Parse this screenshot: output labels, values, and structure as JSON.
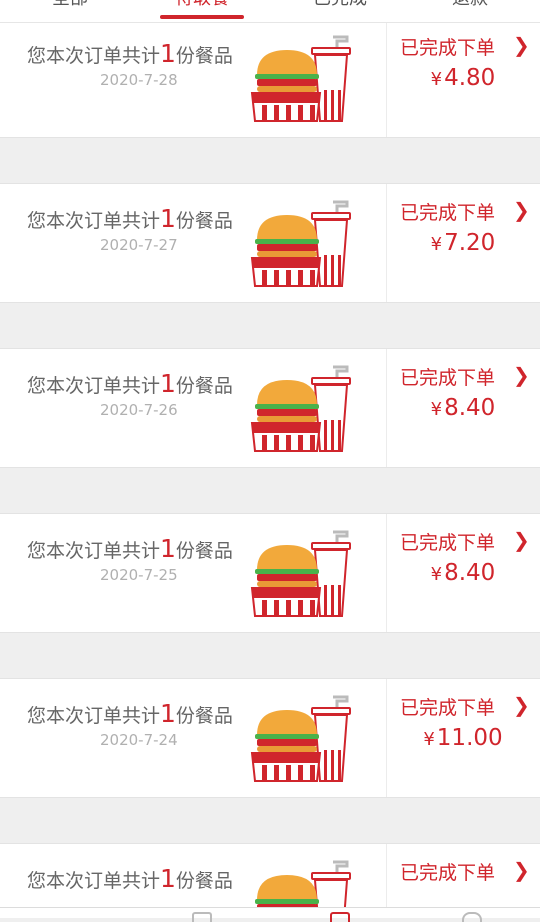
{
  "tabs": [
    {
      "label": "全部"
    },
    {
      "label": "待取餐"
    },
    {
      "label": "已完成"
    },
    {
      "label": "退款"
    }
  ],
  "active_tab": 1,
  "orders": [
    {
      "summary_prefix": "您本次订单共计",
      "count": "1",
      "summary_suffix": "份餐品",
      "date": "2020-7-28",
      "status": "已完成下单",
      "currency": "¥",
      "price": "4.80"
    },
    {
      "summary_prefix": "您本次订单共计",
      "count": "1",
      "summary_suffix": "份餐品",
      "date": "2020-7-27",
      "status": "已完成下单",
      "currency": "¥",
      "price": "7.20"
    },
    {
      "summary_prefix": "您本次订单共计",
      "count": "1",
      "summary_suffix": "份餐品",
      "date": "2020-7-26",
      "status": "已完成下单",
      "currency": "¥",
      "price": "8.40"
    },
    {
      "summary_prefix": "您本次订单共计",
      "count": "1",
      "summary_suffix": "份餐品",
      "date": "2020-7-25",
      "status": "已完成下单",
      "currency": "¥",
      "price": "8.40"
    },
    {
      "summary_prefix": "您本次订单共计",
      "count": "1",
      "summary_suffix": "份餐品",
      "date": "2020-7-24",
      "status": "已完成下单",
      "currency": "¥",
      "price": "11.00"
    },
    {
      "summary_prefix": "您本次订单共计",
      "count": "1",
      "summary_suffix": "份餐品",
      "date": "",
      "status": "已完成下单",
      "currency": "",
      "price": ""
    }
  ],
  "chevron": "❯",
  "colors": {
    "accent": "#d0252c",
    "background": "#efefef",
    "card": "#ffffff"
  },
  "icons": {
    "meal": "burger-drink-icon",
    "chevron": "chevron-right-icon"
  }
}
